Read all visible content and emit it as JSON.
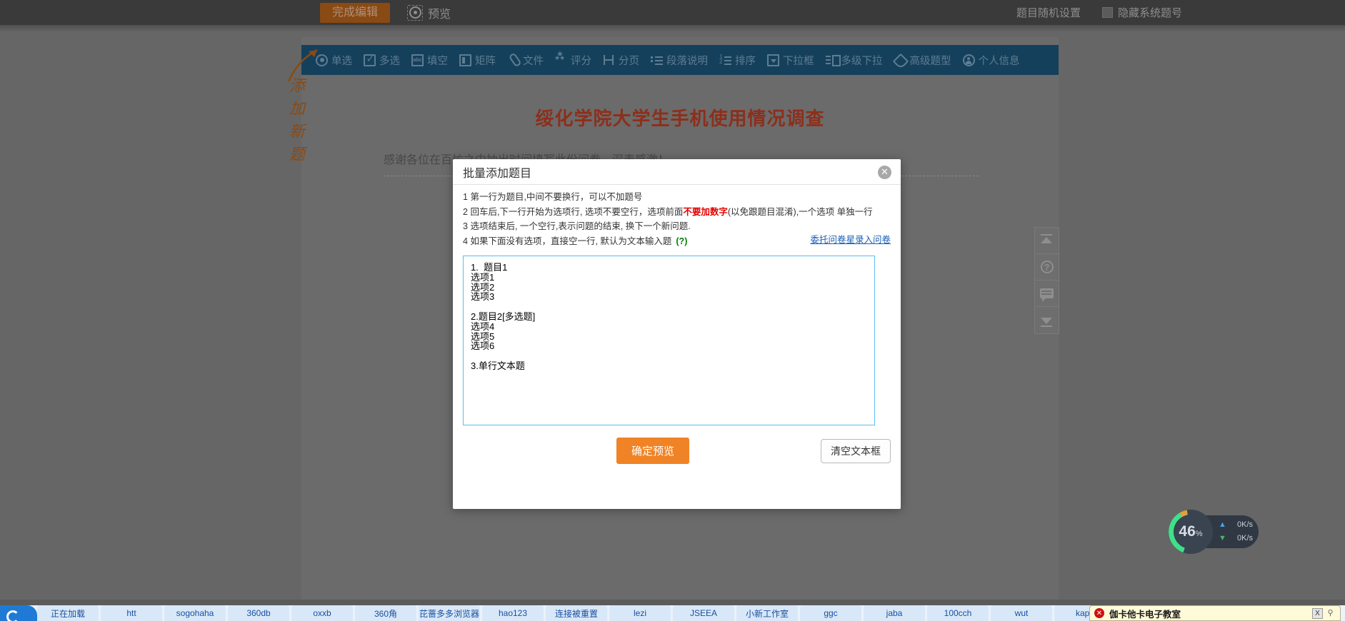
{
  "topbar": {
    "finish_edit": "完成编辑",
    "preview": "预览",
    "preview_icon": "eye-icon",
    "random_settings": "题目随机设置",
    "hide_numbers": "隐藏系统题号"
  },
  "question_toolbar": {
    "items": [
      {
        "label": "单选",
        "icon": "radio-button-icon"
      },
      {
        "label": "多选",
        "icon": "checkbox-icon"
      },
      {
        "label": "填空",
        "icon": "abc-textbox-icon"
      },
      {
        "label": "矩阵",
        "icon": "matrix-grid-icon"
      },
      {
        "label": "文件",
        "icon": "paperclip-icon"
      },
      {
        "label": "评分",
        "icon": "star-rating-icon"
      },
      {
        "label": "分页",
        "icon": "page-break-icon"
      },
      {
        "label": "段落说明",
        "icon": "paragraph-icon"
      },
      {
        "label": "排序",
        "icon": "sort-numbered-icon"
      },
      {
        "label": "下拉框",
        "icon": "dropdown-icon"
      },
      {
        "label": "多级下拉",
        "icon": "cascading-dropdown-icon"
      },
      {
        "label": "高级题型",
        "icon": "advanced-shield-icon"
      },
      {
        "label": "个人信息",
        "icon": "user-icon"
      }
    ]
  },
  "annotation": {
    "text": "添加新题",
    "arrow_icon": "curved-arrow-icon"
  },
  "survey": {
    "title": "绥化学院大学生手机使用情况调查",
    "description": "感谢各位在百忙之中抽出时间填写此份问卷，深表感激！"
  },
  "side_tools": [
    {
      "name": "scroll-to-top",
      "icon": "arrow-up-icon"
    },
    {
      "name": "help",
      "icon": "question-circle-icon"
    },
    {
      "name": "feedback",
      "icon": "speech-bubble-icon"
    },
    {
      "name": "scroll-to-bottom",
      "icon": "arrow-down-icon"
    }
  ],
  "modal": {
    "title": "批量添加题目",
    "close_icon": "close-x-icon",
    "rules": [
      {
        "num": "1 ",
        "pre": "第一行为题目,中间不要换行，可以不加题号",
        "warn": "",
        "post": "",
        "qmark": ""
      },
      {
        "num": "2 ",
        "pre": "回车后,下一行开始为选项行, 选项不要空行，选项前面",
        "warn": "不要加数字",
        "post": "(以免跟题目混淆),一个选项 单独一行",
        "qmark": ""
      },
      {
        "num": "3 ",
        "pre": "选项结束后, 一个空行,表示问题的结束, 换下一个新问题.",
        "warn": "",
        "post": "",
        "qmark": ""
      },
      {
        "num": "4 ",
        "pre": "如果下面没有选项，直接空一行, 默认为文本输入题",
        "warn": "",
        "post": "",
        "qmark": "(?)"
      }
    ],
    "entrust_link": "委托问卷星录入问卷",
    "textarea_value": "1.  题目1\n选项1\n选项2\n选项3\n\n2.题目2[多选题]\n选项4\n选项5\n选项6\n\n3.单行文本题\n",
    "confirm_button": "确定预览",
    "clear_button": "清空文本框"
  },
  "net_widget": {
    "percent": "46",
    "percent_unit": "%",
    "upload": "0K/s",
    "download": "0K/s",
    "upload_icon": "arrow-up-icon",
    "download_icon": "arrow-down-icon"
  },
  "tabstrip": {
    "logo_icon": "browser-logo-icon",
    "tabs": [
      "正在加载",
      "htt",
      "sogohaha",
      "360db",
      "oxxb",
      "360角",
      "芘蔷多多浏览器",
      "hao123",
      "连接被重置",
      "lezi",
      "JSEEA",
      "小新工作室",
      "ggc",
      "jaba",
      "100cch",
      "wut",
      "kapa"
    ]
  },
  "toast": {
    "icon": "error-icon",
    "title": "伽卡他卡电子教室",
    "close_label": "X",
    "pin_icon": "pin-icon"
  }
}
